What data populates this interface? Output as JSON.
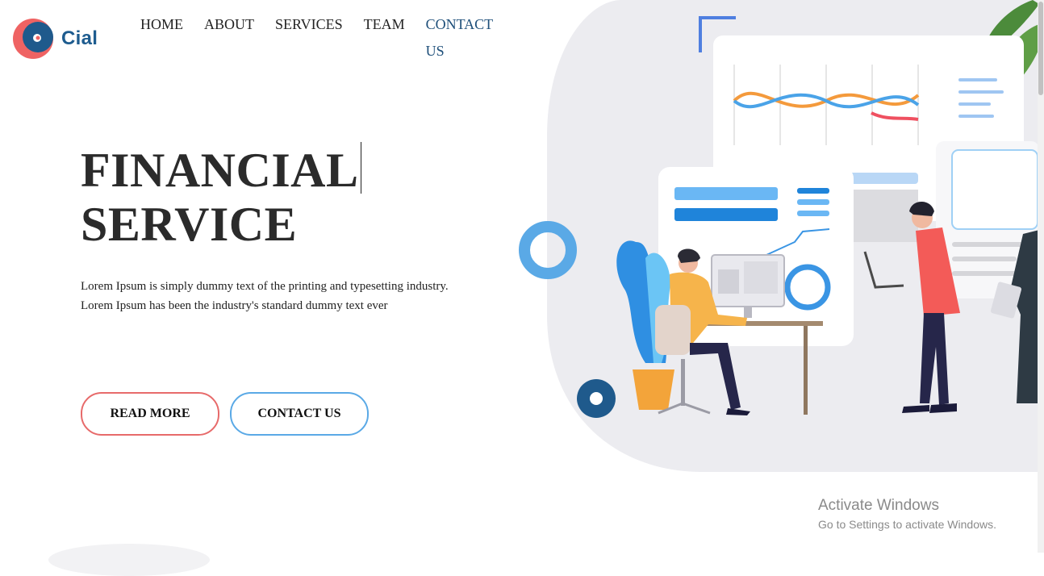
{
  "brand": {
    "name": "Cial",
    "logo_icon": "ring-logo-icon"
  },
  "nav": {
    "items": [
      {
        "label": "HOME",
        "active": false
      },
      {
        "label": "ABOUT",
        "active": false
      },
      {
        "label": "SERVICES",
        "active": false
      },
      {
        "label": "TEAM",
        "active": false
      },
      {
        "label": "CONTACT US",
        "active": true
      }
    ]
  },
  "hero": {
    "title_line1": "FINANCIAL",
    "title_line2": "SERVICE",
    "description_line1": "Lorem Ipsum is simply dummy text of the printing and typesetting industry.",
    "description_line2": "Lorem Ipsum has been the industry's standard dummy text ever",
    "read_more_label": "READ MORE",
    "contact_label": "CONTACT US"
  },
  "illustration": {
    "name": "team-working-on-dashboards-illustration"
  },
  "system": {
    "activate_title": "Activate Windows",
    "activate_sub": "Go to Settings to activate Windows."
  },
  "colors": {
    "accent_red": "#e76a6a",
    "accent_blue": "#5aa9e6",
    "brand_navy": "#1e5c8f",
    "illustration_bg": "#ececf0"
  }
}
